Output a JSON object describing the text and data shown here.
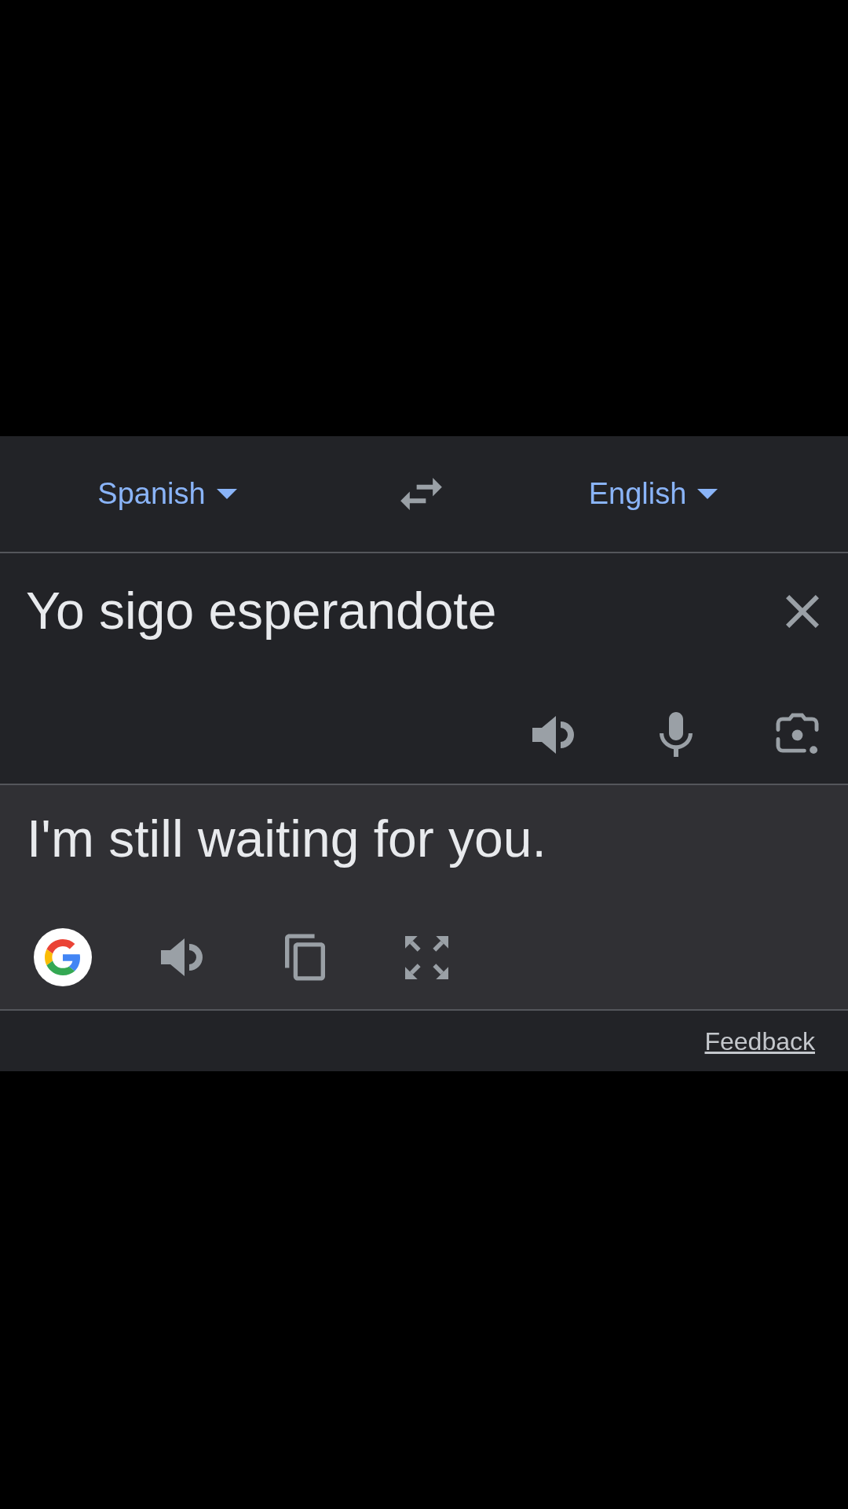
{
  "languages": {
    "source": {
      "label": "Spanish"
    },
    "target": {
      "label": "English"
    }
  },
  "input": {
    "value": "Yo sigo esperandote"
  },
  "output": {
    "text": "I'm still waiting for you."
  },
  "footer": {
    "link": "Feedback"
  }
}
